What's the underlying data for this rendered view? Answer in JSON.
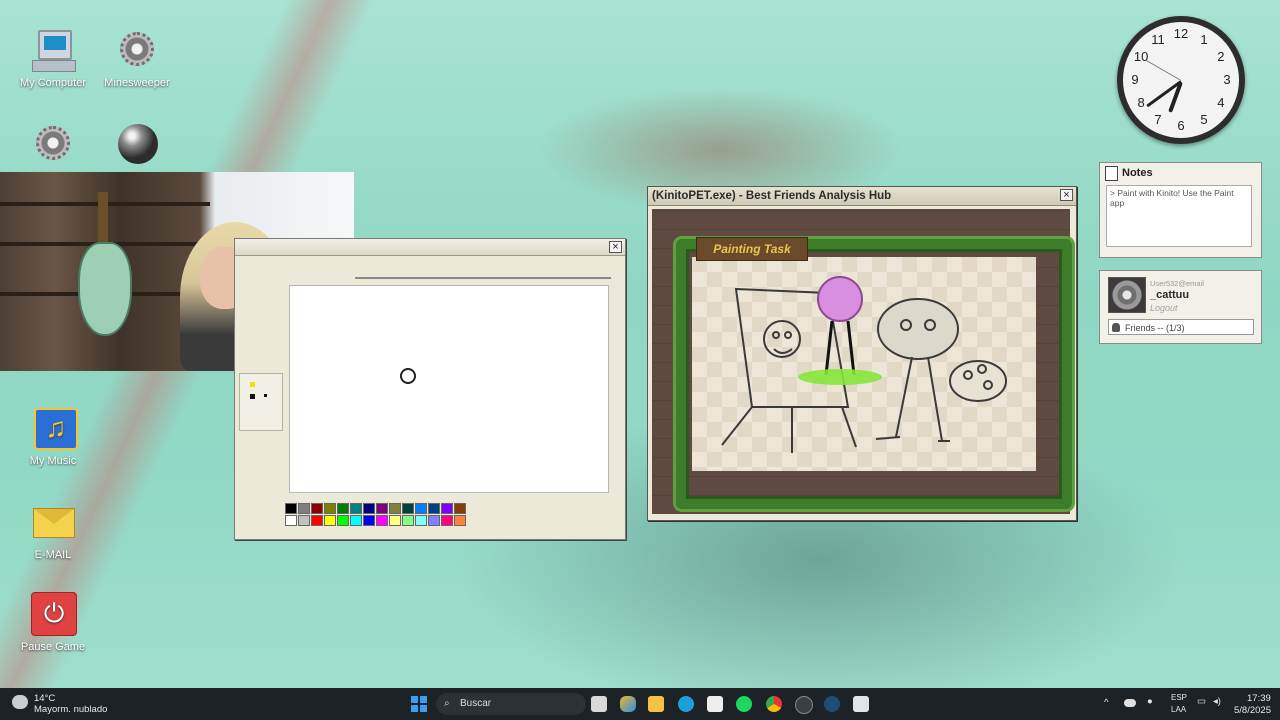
{
  "desktop": {
    "icons": {
      "my_computer": "My Computer",
      "minesweeper": "Minesweeper",
      "my_music": "My Music",
      "email": "E-MAIL",
      "pause_game": "Pause Game"
    }
  },
  "kinito": {
    "title": "(KinitoPET.exe) - Best Friends Analysis Hub",
    "task_sign": "Painting Task"
  },
  "paint": {
    "palette": [
      "#000000",
      "#7f7f7f",
      "#8b0000",
      "#808000",
      "#008000",
      "#008080",
      "#000080",
      "#800080",
      "#808040",
      "#004040",
      "#0080ff",
      "#004080",
      "#8000ff",
      "#804000",
      "#ffffff",
      "#c0c0c0",
      "#ff0000",
      "#ffff00",
      "#00ff00",
      "#00ffff",
      "#0000ff",
      "#ff00ff",
      "#ffff80",
      "#80ff80",
      "#80ffff",
      "#8080ff",
      "#ff0080",
      "#ff8040"
    ]
  },
  "notes": {
    "title": "Notes",
    "body": "> Paint with Kinito! Use the Paint app"
  },
  "friends": {
    "email": "User532@email",
    "username": "_cattuu",
    "logout": "Logout",
    "friends_label": "Friends -- (1/3)"
  },
  "clock": {
    "numbers": [
      "12",
      "1",
      "2",
      "3",
      "4",
      "5",
      "6",
      "7",
      "8",
      "9",
      "10",
      "11"
    ]
  },
  "taskbar": {
    "weather_temp": "14°C",
    "weather_desc": "Mayorm. nublado",
    "search_placeholder": "Buscar",
    "lang_top": "ESP",
    "lang_bottom": "LAA",
    "time": "17:39",
    "date": "5/8/2025"
  }
}
